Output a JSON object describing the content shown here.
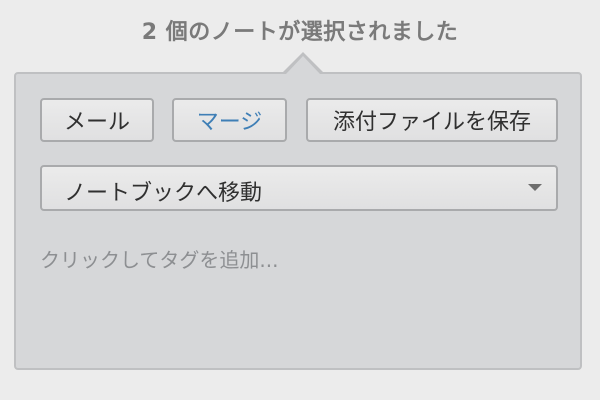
{
  "header": {
    "title": "2 個のノートが選択されました"
  },
  "actions": {
    "mail_label": "メール",
    "merge_label": "マージ",
    "save_attachments_label": "添付ファイルを保存"
  },
  "notebook_select": {
    "label": "ノートブックへ移動",
    "icon": "chevron-down-icon"
  },
  "tags": {
    "placeholder": "クリックしてタグを追加..."
  },
  "colors": {
    "merge_text": "#3f7fb6",
    "panel_bg": "#d6d7d9",
    "background": "#ececec"
  }
}
